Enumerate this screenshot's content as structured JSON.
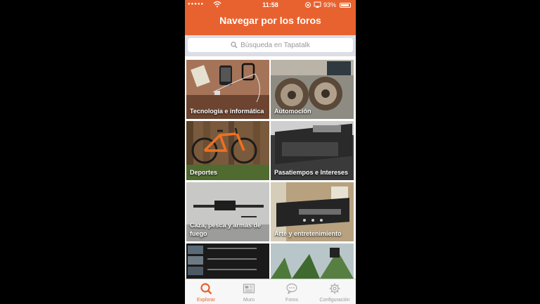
{
  "status_bar": {
    "carrier": "●●●●●",
    "time": "11:58",
    "battery": "93%",
    "battery_level": 0.93
  },
  "header": {
    "title": "Navegar por los foros"
  },
  "search": {
    "placeholder": "Búsqueda en Tapatalk",
    "icon": "search-icon"
  },
  "categories": [
    {
      "label": "Tecnología e informática"
    },
    {
      "label": "Automoción"
    },
    {
      "label": "Deportes"
    },
    {
      "label": "Pasatiempos e Intereses"
    },
    {
      "label": "Caza, pesca y armas de fuego"
    },
    {
      "label": "Arte y entretenimiento"
    },
    {
      "label": ""
    },
    {
      "label": ""
    }
  ],
  "tabs": [
    {
      "label": "Explorar",
      "icon": "explore-search-icon",
      "active": true
    },
    {
      "label": "Muro",
      "icon": "newspaper-icon",
      "active": false
    },
    {
      "label": "Foros",
      "icon": "chat-bubble-icon",
      "active": false
    },
    {
      "label": "Configuración",
      "icon": "gear-icon",
      "active": false
    }
  ],
  "colors": {
    "accent": "#e8622f",
    "tab_inactive": "#999999"
  }
}
